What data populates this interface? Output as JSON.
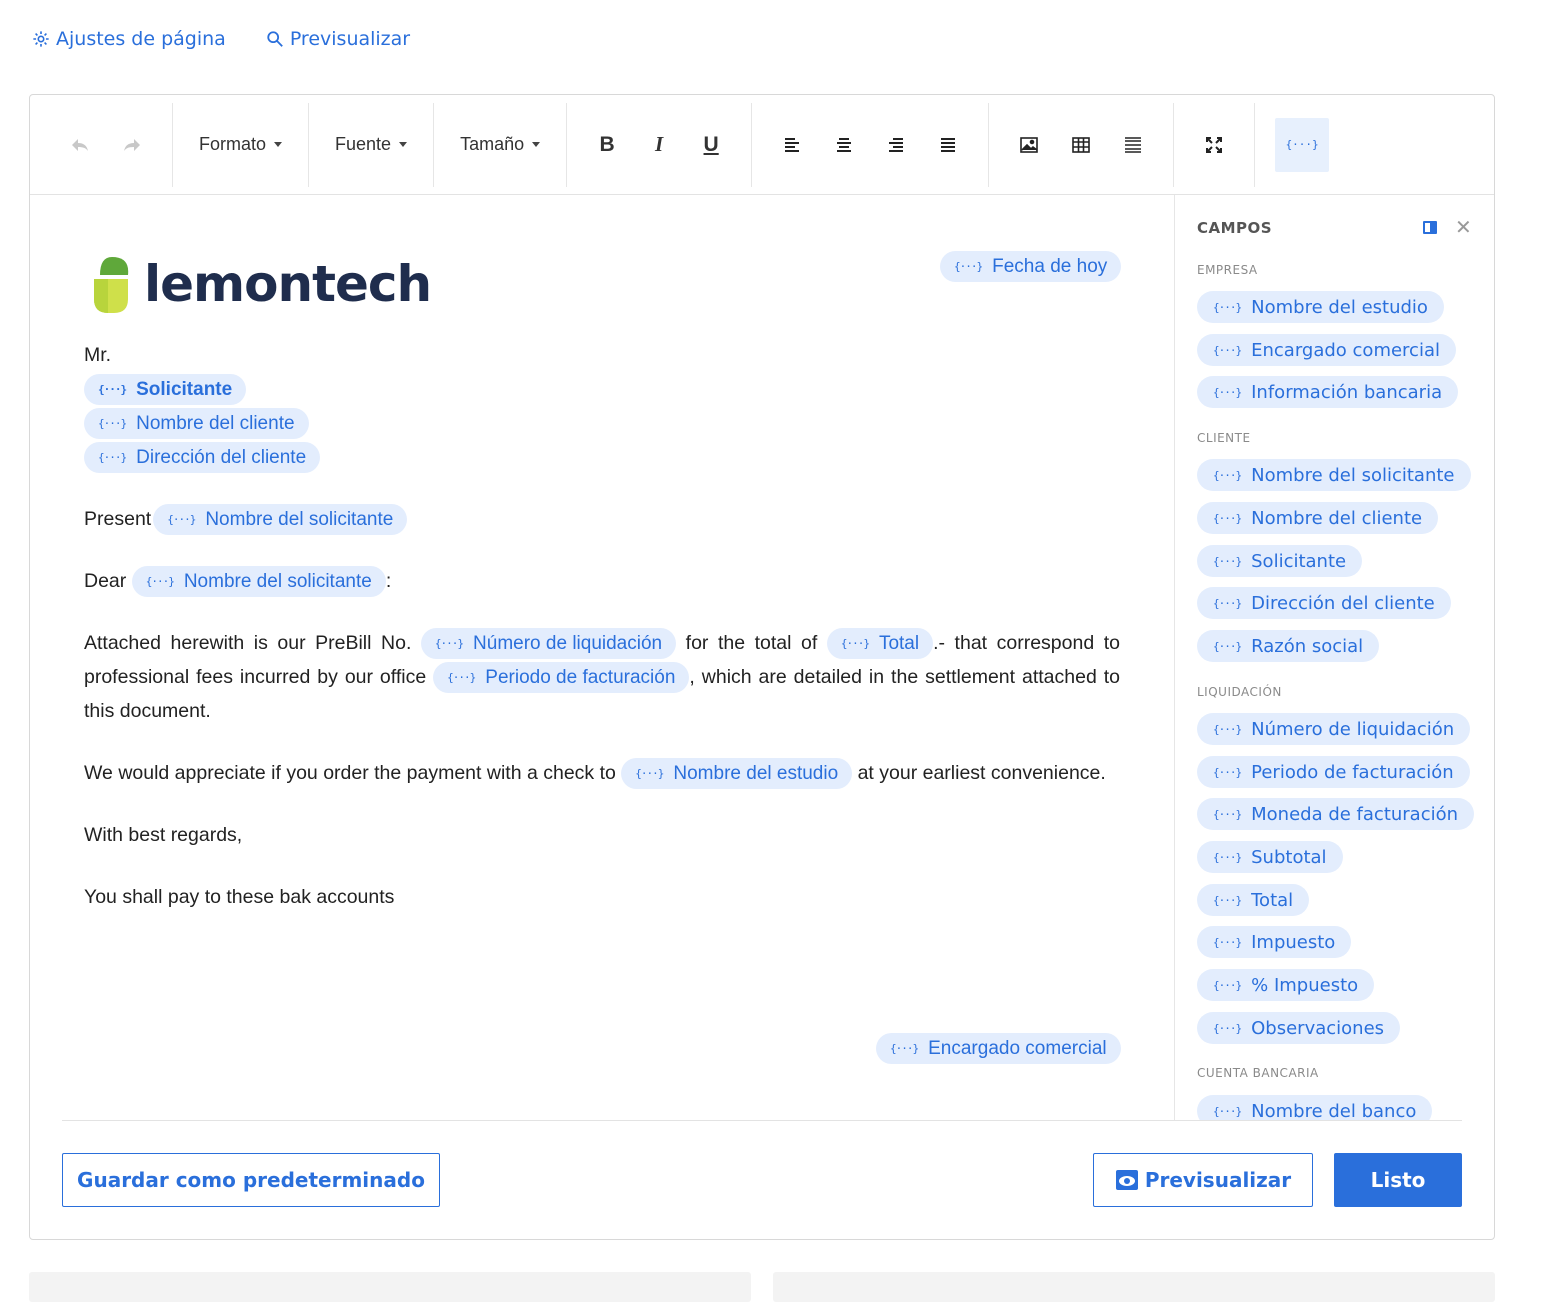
{
  "top_links": {
    "page_settings": "Ajustes de página",
    "preview": "Previsualizar"
  },
  "toolbar": {
    "format": "Formato",
    "font": "Fuente",
    "size": "Tamaño",
    "bold": "B",
    "italic": "I",
    "underline": "U",
    "fields_toggle": "{···}"
  },
  "document": {
    "logo_text": "lemontech",
    "date_field": "Fecha de hoy",
    "salutation": "Mr.",
    "field_applicant": "Solicitante",
    "field_client_name": "Nombre del cliente",
    "field_client_address": "Dirección del cliente",
    "present_label": "Present",
    "field_applicant_name_1": "Nombre del solicitante",
    "dear_label": "Dear",
    "field_applicant_name_2": "Nombre del solicitante",
    "colon": ":",
    "p1_a": "Attached herewith is our PreBill No.",
    "field_settlement_number": "Número de liquidación",
    "p1_b": "for the total of",
    "field_total": "Total",
    "p1_c": ".- that correspond to professional fees incurred by our office",
    "field_billing_period": "Periodo de facturación",
    "p1_d": ", which are detailed in the settlement attached to this document.",
    "p2_a": "We would appreciate if you order the payment with a check to",
    "field_firm_name": "Nombre del estudio",
    "p2_b": "at your earliest convenience.",
    "regards": "With best regards,",
    "pay_line": "You shall pay to these bak accounts",
    "field_commercial_manager": "Encargado comercial",
    "field_icon": "{···}"
  },
  "sidebar": {
    "title": "CAMPOS",
    "sections": [
      {
        "name": "EMPRESA",
        "items": [
          "Nombre del estudio",
          "Encargado comercial",
          "Información bancaria"
        ]
      },
      {
        "name": "CLIENTE",
        "items": [
          "Nombre del solicitante",
          "Nombre del cliente",
          "Solicitante",
          "Dirección del cliente",
          "Razón social"
        ]
      },
      {
        "name": "LIQUIDACIÓN",
        "items": [
          "Número de liquidación",
          "Periodo de facturación",
          "Moneda de facturación",
          "Subtotal",
          "Total",
          "Impuesto",
          "% Impuesto",
          "Observaciones"
        ]
      },
      {
        "name": "CUENTA BANCARIA",
        "items": [
          "Nombre del banco"
        ]
      }
    ]
  },
  "footer": {
    "save_default": "Guardar como predeterminado",
    "preview": "Previsualizar",
    "done": "Listo"
  },
  "colors": {
    "accent": "#2a6fdb",
    "pill_bg": "#e3edfd",
    "logo_green": "#8cc63f",
    "logo_text": "#1f2d4d"
  }
}
